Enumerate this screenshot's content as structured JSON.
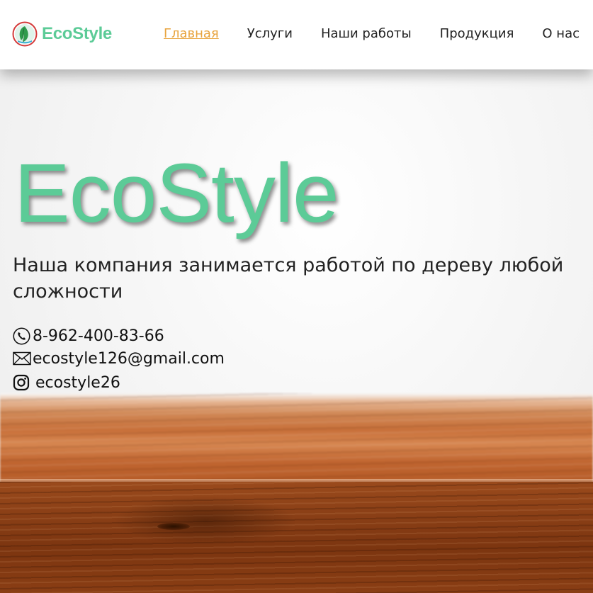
{
  "header": {
    "brand_name": "EcoStyle",
    "logo_icon": "eco-leaf-globe-icon",
    "nav": [
      {
        "label": "Главная",
        "active": true
      },
      {
        "label": "Услуги",
        "active": false
      },
      {
        "label": "Наши работы",
        "active": false
      },
      {
        "label": "Продукция",
        "active": false
      },
      {
        "label": "О нас",
        "active": false
      }
    ]
  },
  "hero": {
    "title": "EcoStyle",
    "subtitle": "Наша компания занимается работой по дереву любой сложности",
    "contacts": {
      "phone": {
        "icon": "phone-icon",
        "value": "8-962-400-83-66"
      },
      "email": {
        "icon": "envelope-icon",
        "value": "ecostyle126@gmail.com"
      },
      "instagram": {
        "icon": "instagram-icon",
        "value": "ecostyle26"
      }
    }
  },
  "colors": {
    "brand_green": "#5ccb97",
    "active_nav": "#e8a33c",
    "text_dark": "#222222",
    "header_bg": "#ffffff"
  }
}
